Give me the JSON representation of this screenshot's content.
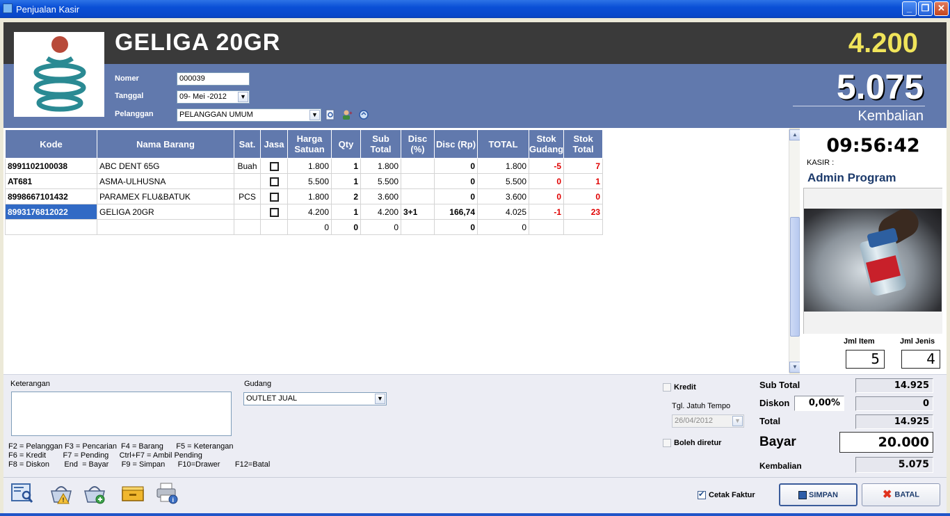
{
  "window": {
    "title": "Penjualan Kasir",
    "min": "_",
    "max": "❐",
    "close": "✕"
  },
  "header": {
    "product_name": "GELIGA 20GR",
    "price": "4.200",
    "change_amount": "5.075",
    "change_label": "Kembalian"
  },
  "form": {
    "nomer_label": "Nomer",
    "nomer_value": "000039",
    "tanggal_label": "Tanggal",
    "tanggal_value": "09- Mei -2012",
    "pelanggan_label": "Pelanggan",
    "pelanggan_value": "PELANGGAN UMUM"
  },
  "grid": {
    "headers": [
      "Kode",
      "Nama Barang",
      "Sat.",
      "Jasa",
      "Harga Satuan",
      "Qty",
      "Sub Total",
      "Disc (%)",
      "Disc (Rp)",
      "TOTAL",
      "Stok Gudang",
      "Stok Total"
    ],
    "rows": [
      {
        "kode": "8991102100038",
        "nama": "ABC DENT 65G",
        "sat": "Buah",
        "harga": "1.800",
        "qty": "1",
        "sub": "1.800",
        "disc_pct": "",
        "disc_rp": "0",
        "total": "1.800",
        "stok_gudang": "-5",
        "stok_total": "7"
      },
      {
        "kode": "AT681",
        "nama": "ASMA-ULHUSNA",
        "sat": "",
        "harga": "5.500",
        "qty": "1",
        "sub": "5.500",
        "disc_pct": "",
        "disc_rp": "0",
        "total": "5.500",
        "stok_gudang": "0",
        "stok_total": "1"
      },
      {
        "kode": "8998667101432",
        "nama": "PARAMEX FLU&BATUK",
        "sat": "PCS",
        "harga": "1.800",
        "qty": "2",
        "sub": "3.600",
        "disc_pct": "",
        "disc_rp": "0",
        "total": "3.600",
        "stok_gudang": "0",
        "stok_total": "0"
      },
      {
        "kode": "8993176812022",
        "nama": "GELIGA 20GR",
        "sat": "",
        "harga": "4.200",
        "qty": "1",
        "sub": "4.200",
        "disc_pct": "3+1",
        "disc_rp": "166,74",
        "total": "4.025",
        "stok_gudang": "-1",
        "stok_total": "23"
      },
      {
        "kode": "",
        "nama": "",
        "sat": "",
        "harga": "0",
        "qty": "0",
        "sub": "0",
        "disc_pct": "",
        "disc_rp": "0",
        "total": "0",
        "stok_gudang": "",
        "stok_total": ""
      }
    ]
  },
  "side": {
    "clock": "09:56:42",
    "kasir_label": "KASIR :",
    "kasir_name": "Admin Program",
    "jml_item_label": "Jml Item",
    "jml_item": "5",
    "jml_jenis_label": "Jml Jenis",
    "jml_jenis": "4"
  },
  "bottom": {
    "keterangan_label": "Keterangan",
    "gudang_label": "Gudang",
    "gudang_value": "OUTLET JUAL",
    "shortcuts": [
      "F2 = Pelanggan F3 = Pencarian  F4 = Barang      F5 = Keterangan",
      "F6 = Kredit        F7 = Pending     Ctrl+F7 = Ambil Pending",
      "F8 = Diskon       End  = Bayar      F9 = Simpan      F10=Drawer       F12=Batal"
    ],
    "kredit_label": "Kredit",
    "jatuh_tempo_label": "Tgl. Jatuh Tempo",
    "jatuh_tempo_value": "26/04/2012",
    "boleh_diretur_label": "Boleh diretur",
    "subtotal_label": "Sub Total",
    "subtotal_value": "14.925",
    "diskon_label": "Diskon",
    "diskon_pct": "0,00%",
    "diskon_value": "0",
    "total_label": "Total",
    "total_value": "14.925",
    "bayar_label": "Bayar",
    "bayar_value": "20.000",
    "kembalian_label": "Kembalian",
    "kembalian_value": "5.075"
  },
  "toolbar": {
    "cetak_faktur_label": "Cetak Faktur",
    "simpan_label": "SIMPAN",
    "batal_label": "BATAL"
  },
  "colors": {
    "header_dark": "#3a3a3a",
    "header_blue": "#6179ad",
    "price_yellow": "#f0e45a",
    "stock_red": "#e00000",
    "selection": "#316ac5"
  }
}
